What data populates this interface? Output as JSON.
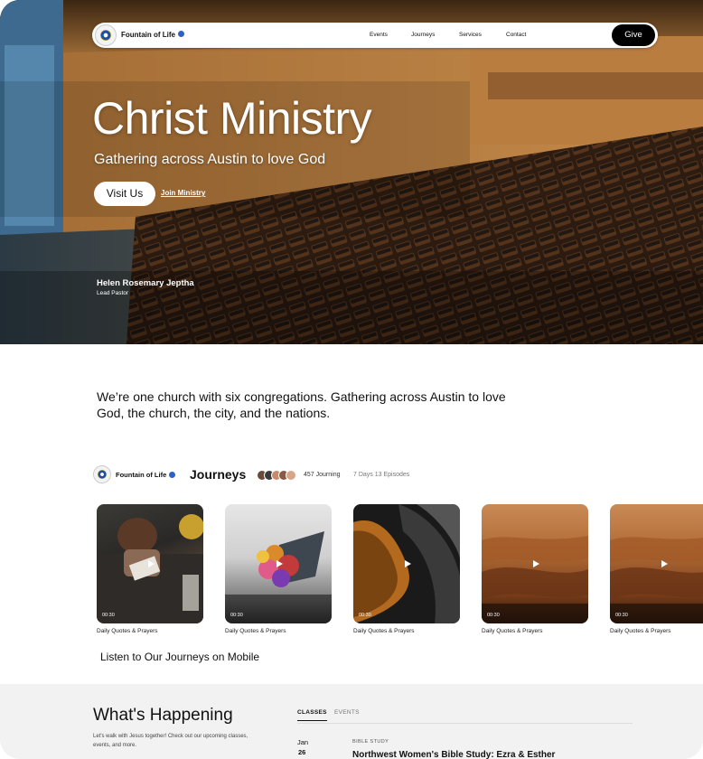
{
  "nav": {
    "brand": "Fountain of Life",
    "links": [
      "Events",
      "Journeys",
      "Services",
      "Contact"
    ],
    "give_label": "Give"
  },
  "hero": {
    "title": "Christ Ministry",
    "subtitle": "Gathering across Austin to love God",
    "visit_label": "Visit Us",
    "join_label": "Join Ministry",
    "pastor_name": "Helen Rosemary Jeptha",
    "pastor_role": "Lead Pastor"
  },
  "intro": {
    "text": "We’re one church with six congregations. Gathering across Austin to love God, the church, the city, and the nations."
  },
  "journeys": {
    "brand": "Fountain of Life",
    "title": "Journeys",
    "journeying_count": "457 Journing",
    "meta": "7 Days 13 Episodes",
    "cards": [
      {
        "duration": "00:30",
        "caption": "Daily Quotes & Prayers",
        "image": "people-studying-bible"
      },
      {
        "duration": "00:30",
        "caption": "Daily Quotes & Prayers",
        "image": "flowers-and-book"
      },
      {
        "duration": "00:30",
        "caption": "Daily Quotes & Prayers",
        "image": "abstract-dark-shape"
      },
      {
        "duration": "00:30",
        "caption": "Daily Quotes & Prayers",
        "image": "desert-dunes"
      },
      {
        "duration": "00:30",
        "caption": "Daily Quotes & Prayers",
        "image": "desert-dunes"
      }
    ],
    "listen_label": "Listen to Our  Journeys on Mobile"
  },
  "happening": {
    "title": "What's Happening",
    "description": "Let's walk with Jesus together! Check out our upcoming classes, events, and more.",
    "tabs": [
      "CLASSES",
      "EVENTS"
    ],
    "active_tab": "CLASSES",
    "event": {
      "month": "Jan",
      "day": "26",
      "category": "BIBLE STUDY",
      "title": "Northwest Women's Bible Study: Ezra & Esther"
    }
  },
  "colors": {
    "accent": "#000000",
    "verified": "#2a62c9",
    "section_bg": "#f2f2f2"
  }
}
